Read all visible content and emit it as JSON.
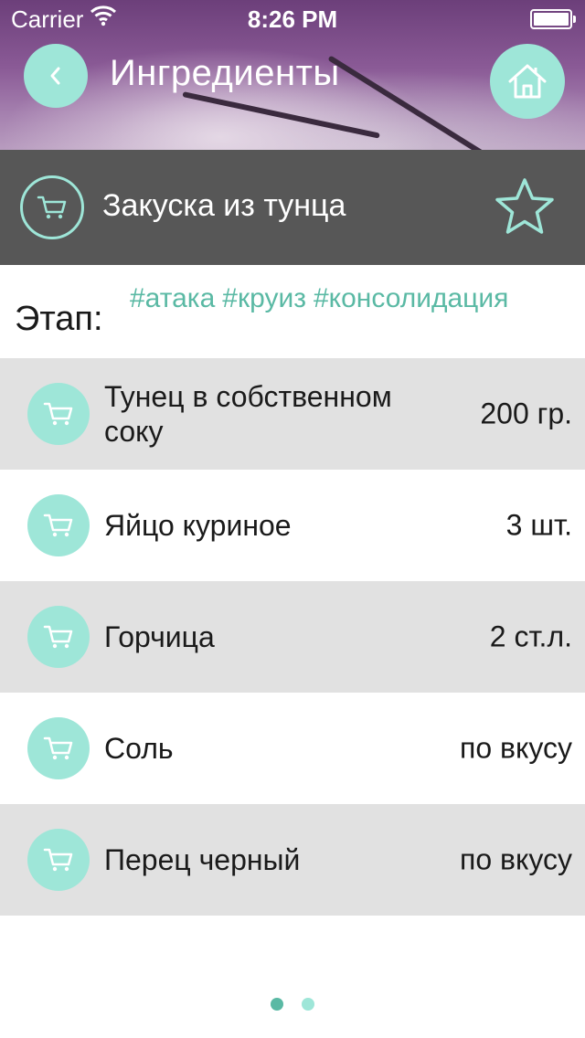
{
  "status_bar": {
    "carrier": "Carrier",
    "time": "8:26 PM"
  },
  "nav": {
    "title": "Ингредиенты",
    "back_icon": "chevron-left-icon",
    "home_icon": "home-icon"
  },
  "recipe": {
    "title": "Закуска из тунца",
    "cart_icon": "cart-icon",
    "favorite_icon": "star-icon"
  },
  "stage": {
    "label": "Этап:",
    "tags": [
      "#атака",
      "#круиз",
      "#консолидация"
    ]
  },
  "ingredients": [
    {
      "name": "Тунец в собственном соку",
      "qty": "200 гр."
    },
    {
      "name": "Яйцо куриное",
      "qty": "3 шт."
    },
    {
      "name": "Горчица",
      "qty": "2 ст.л."
    },
    {
      "name": "Соль",
      "qty": "по вкусу"
    },
    {
      "name": "Перец черный",
      "qty": "по вкусу"
    }
  ],
  "pager": {
    "total": 2,
    "current": 1
  },
  "colors": {
    "accent": "#9ee6d8",
    "tag": "#5ab9a4",
    "bar": "#575757",
    "row_shaded": "#e1e1e1"
  }
}
